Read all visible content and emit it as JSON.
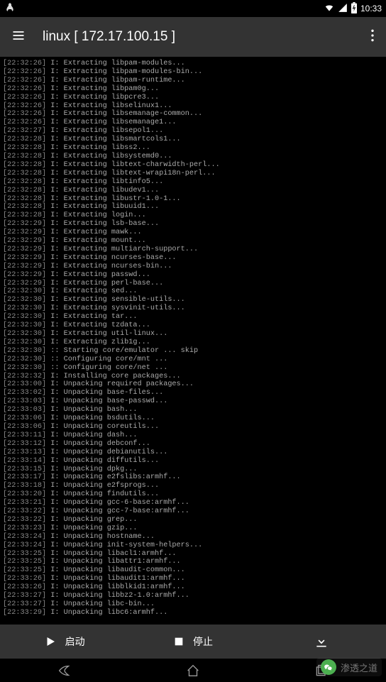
{
  "status": {
    "time": "10:33"
  },
  "appbar": {
    "title": "linux  [ 172.17.100.15 ]"
  },
  "terminal": {
    "lines": [
      {
        "ts": "[22:32:26]",
        "txt": " I: Extracting libpam-modules..."
      },
      {
        "ts": "[22:32:26]",
        "txt": " I: Extracting libpam-modules-bin..."
      },
      {
        "ts": "[22:32:26]",
        "txt": " I: Extracting libpam-runtime..."
      },
      {
        "ts": "[22:32:26]",
        "txt": " I: Extracting libpam0g..."
      },
      {
        "ts": "[22:32:26]",
        "txt": " I: Extracting libpcre3..."
      },
      {
        "ts": "[22:32:26]",
        "txt": " I: Extracting libselinux1..."
      },
      {
        "ts": "[22:32:26]",
        "txt": " I: Extracting libsemanage-common..."
      },
      {
        "ts": "[22:32:26]",
        "txt": " I: Extracting libsemanage1..."
      },
      {
        "ts": "[22:32:27]",
        "txt": " I: Extracting libsepol1..."
      },
      {
        "ts": "[22:32:28]",
        "txt": " I: Extracting libsmartcols1..."
      },
      {
        "ts": "[22:32:28]",
        "txt": " I: Extracting libss2..."
      },
      {
        "ts": "[22:32:28]",
        "txt": " I: Extracting libsystemd0..."
      },
      {
        "ts": "[22:32:28]",
        "txt": " I: Extracting libtext-charwidth-perl..."
      },
      {
        "ts": "[22:32:28]",
        "txt": " I: Extracting libtext-wrapi18n-perl..."
      },
      {
        "ts": "[22:32:28]",
        "txt": " I: Extracting libtinfo5..."
      },
      {
        "ts": "[22:32:28]",
        "txt": " I: Extracting libudev1..."
      },
      {
        "ts": "[22:32:28]",
        "txt": " I: Extracting libustr-1.0-1..."
      },
      {
        "ts": "[22:32:28]",
        "txt": " I: Extracting libuuid1..."
      },
      {
        "ts": "[22:32:28]",
        "txt": " I: Extracting login..."
      },
      {
        "ts": "[22:32:29]",
        "txt": " I: Extracting lsb-base..."
      },
      {
        "ts": "[22:32:29]",
        "txt": " I: Extracting mawk..."
      },
      {
        "ts": "[22:32:29]",
        "txt": " I: Extracting mount..."
      },
      {
        "ts": "[22:32:29]",
        "txt": " I: Extracting multiarch-support..."
      },
      {
        "ts": "[22:32:29]",
        "txt": " I: Extracting ncurses-base..."
      },
      {
        "ts": "[22:32:29]",
        "txt": " I: Extracting ncurses-bin..."
      },
      {
        "ts": "[22:32:29]",
        "txt": " I: Extracting passwd..."
      },
      {
        "ts": "[22:32:29]",
        "txt": " I: Extracting perl-base..."
      },
      {
        "ts": "[22:32:30]",
        "txt": " I: Extracting sed..."
      },
      {
        "ts": "[22:32:30]",
        "txt": " I: Extracting sensible-utils..."
      },
      {
        "ts": "[22:32:30]",
        "txt": " I: Extracting sysvinit-utils..."
      },
      {
        "ts": "[22:32:30]",
        "txt": " I: Extracting tar..."
      },
      {
        "ts": "[22:32:30]",
        "txt": " I: Extracting tzdata..."
      },
      {
        "ts": "[22:32:30]",
        "txt": " I: Extracting util-linux..."
      },
      {
        "ts": "[22:32:30]",
        "txt": " I: Extracting zlib1g..."
      },
      {
        "ts": "[22:32:30]",
        "txt": " :: Starting core/emulator ... skip"
      },
      {
        "ts": "[22:32:30]",
        "txt": " :: Configuring core/mnt ..."
      },
      {
        "ts": "[22:32:30]",
        "txt": " :: Configuring core/net ..."
      },
      {
        "ts": "[22:32:32]",
        "txt": " I: Installing core packages..."
      },
      {
        "ts": "[22:33:00]",
        "txt": " I: Unpacking required packages..."
      },
      {
        "ts": "[22:33:02]",
        "txt": " I: Unpacking base-files..."
      },
      {
        "ts": "[22:33:03]",
        "txt": " I: Unpacking base-passwd..."
      },
      {
        "ts": "[22:33:03]",
        "txt": " I: Unpacking bash..."
      },
      {
        "ts": "[22:33:06]",
        "txt": " I: Unpacking bsdutils..."
      },
      {
        "ts": "[22:33:06]",
        "txt": " I: Unpacking coreutils..."
      },
      {
        "ts": "[22:33:11]",
        "txt": " I: Unpacking dash..."
      },
      {
        "ts": "[22:33:12]",
        "txt": " I: Unpacking debconf..."
      },
      {
        "ts": "[22:33:13]",
        "txt": " I: Unpacking debianutils..."
      },
      {
        "ts": "[22:33:14]",
        "txt": " I: Unpacking diffutils..."
      },
      {
        "ts": "[22:33:15]",
        "txt": " I: Unpacking dpkg..."
      },
      {
        "ts": "[22:33:17]",
        "txt": " I: Unpacking e2fslibs:armhf..."
      },
      {
        "ts": "[22:33:18]",
        "txt": " I: Unpacking e2fsprogs..."
      },
      {
        "ts": "[22:33:20]",
        "txt": " I: Unpacking findutils..."
      },
      {
        "ts": "[22:33:21]",
        "txt": " I: Unpacking gcc-6-base:armhf..."
      },
      {
        "ts": "[22:33:22]",
        "txt": " I: Unpacking gcc-7-base:armhf..."
      },
      {
        "ts": "[22:33:22]",
        "txt": " I: Unpacking grep..."
      },
      {
        "ts": "[22:33:23]",
        "txt": " I: Unpacking gzip..."
      },
      {
        "ts": "[22:33:24]",
        "txt": " I: Unpacking hostname..."
      },
      {
        "ts": "[22:33:24]",
        "txt": " I: Unpacking init-system-helpers..."
      },
      {
        "ts": "[22:33:25]",
        "txt": " I: Unpacking libacl1:armhf..."
      },
      {
        "ts": "[22:33:25]",
        "txt": " I: Unpacking libattr1:armhf..."
      },
      {
        "ts": "[22:33:25]",
        "txt": " I: Unpacking libaudit-common..."
      },
      {
        "ts": "[22:33:26]",
        "txt": " I: Unpacking libaudit1:armhf..."
      },
      {
        "ts": "[22:33:26]",
        "txt": " I: Unpacking libblkid1:armhf..."
      },
      {
        "ts": "[22:33:27]",
        "txt": " I: Unpacking libbz2-1.0:armhf..."
      },
      {
        "ts": "[22:33:27]",
        "txt": " I: Unpacking libc-bin..."
      },
      {
        "ts": "[22:33:29]",
        "txt": " I: Unpacking libc6:armhf..."
      }
    ]
  },
  "bottom": {
    "start_label": "启动",
    "stop_label": "停止"
  },
  "watermark": {
    "text": "渗透之道"
  }
}
